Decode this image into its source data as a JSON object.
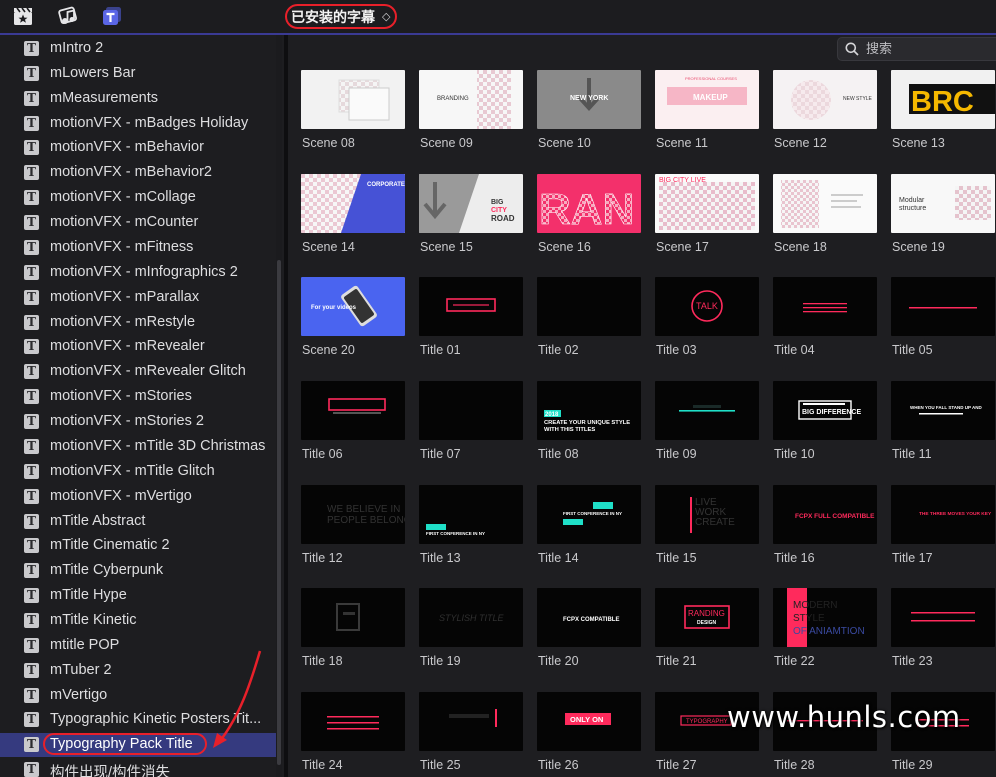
{
  "toolbar": {
    "library_selector": "已安装的字幕",
    "library_selector_chevron": "◇",
    "icons": [
      "clapboard-star-icon",
      "music-photo-icon",
      "titles-icon"
    ]
  },
  "search": {
    "placeholder": "搜索"
  },
  "sidebar": {
    "items": [
      "mIntro 2",
      "mLowers Bar",
      "mMeasurements",
      "motionVFX - mBadges Holiday",
      "motionVFX - mBehavior",
      "motionVFX - mBehavior2",
      "motionVFX - mCollage",
      "motionVFX - mCounter",
      "motionVFX - mFitness",
      "motionVFX - mInfographics 2",
      "motionVFX - mParallax",
      "motionVFX - mRestyle",
      "motionVFX - mRevealer",
      "motionVFX - mRevealer Glitch",
      "motionVFX - mStories",
      "motionVFX - mStories 2",
      "motionVFX - mTitle 3D Christmas",
      "motionVFX - mTitle Glitch",
      "motionVFX - mVertigo",
      "mTitle Abstract",
      "mTitle Cinematic 2",
      "mTitle Cyberpunk",
      "mTitle Hype",
      "mTitle Kinetic",
      "mtitle POP",
      "mTuber 2",
      "mVertigo",
      "Typographic Kinetic Posters Tit...",
      "Typography Pack Title",
      "构件出现/构件消失"
    ],
    "selected_index": 28,
    "item_icon_glyph": "T"
  },
  "grid": {
    "tiles": [
      "Scene 08",
      "Scene 09",
      "Scene 10",
      "Scene 11",
      "Scene 12",
      "Scene 13",
      "Scene 14",
      "Scene 15",
      "Scene 16",
      "Scene 17",
      "Scene 18",
      "Scene 19",
      "Scene 20",
      "Title 01",
      "Title 02",
      "Title 03",
      "Title 04",
      "Title 05",
      "Title 06",
      "Title 07",
      "Title 08",
      "Title 09",
      "Title 10",
      "Title 11",
      "Title 12",
      "Title 13",
      "Title 14",
      "Title 15",
      "Title 16",
      "Title 17",
      "Title 18",
      "Title 19",
      "Title 20",
      "Title 21",
      "Title 22",
      "Title 23",
      "Title 24",
      "Title 25",
      "Title 26",
      "Title 27",
      "Title 28",
      "Title 29"
    ],
    "thumb_text": {
      "scene09": "BRANDING",
      "scene10": "NEW YORK",
      "scene11": "MAKEUP",
      "scene11_top": "PROFESSIONAL COURSES",
      "scene12": "NEW STYLE",
      "scene13": "BRC",
      "scene14": "CORPORATE",
      "scene15_a": "BIG",
      "scene15_b": "CITY",
      "scene15_c": "ROAD",
      "scene16": "RAN",
      "scene17": "BIG CITY LIVE",
      "scene19_a": "Modular",
      "scene19_b": "structure",
      "scene20_a": "For your videos",
      "title03": "TALK",
      "title08_a": "2018",
      "title08_b": "CREATE YOUR UNIQUE STYLE",
      "title08_c": "WITH THIS TITLES",
      "title10": "BIG DIFFERENCE",
      "title11": "WHEN YOU FALL STAND UP AND",
      "title12_a": "WE BELIEVE IN",
      "title12_b": "PEOPLE BELONG",
      "title13": "FIRST CONFERENCE IN NY",
      "title14": "FIRST CONFERENCE IN NY",
      "title15_a": "LIVE",
      "title15_b": "WORK",
      "title15_c": "CREATE",
      "title16": "FCPX FULL COMPATIBLE",
      "title17": "THE THREE MOVES YOUR KEY",
      "title19": "STYLISH TITLE",
      "title20": "FCPX COMPATIBLE",
      "title21_a": "RANDING",
      "title21_b": "DESIGN",
      "title22_a": "MODERN",
      "title22_b": "STYLE",
      "title22_c": "OF ANIAMTION",
      "title26": "ONLY ON",
      "title27": "TYPOGRAPHY"
    }
  },
  "watermark": "www.hunls.com",
  "colors": {
    "accent": "#353a7f",
    "annotation_red": "#e8202a",
    "thumb_pink": "#ff2a5c",
    "thumb_cyan": "#1fe0c8"
  }
}
